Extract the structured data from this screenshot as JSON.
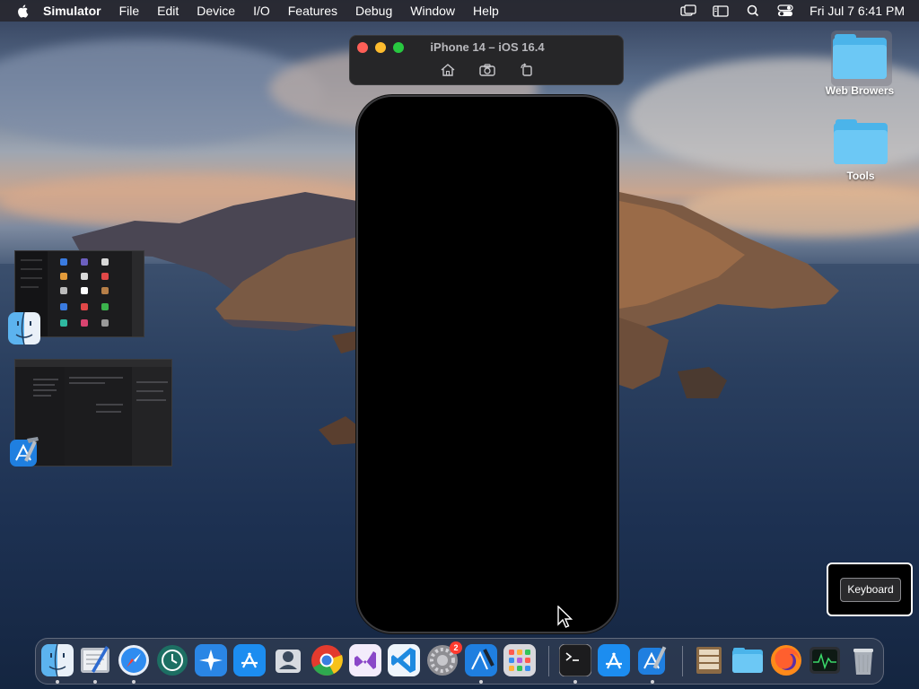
{
  "menubar": {
    "app_name": "Simulator",
    "items": [
      "File",
      "Edit",
      "Device",
      "I/O",
      "Features",
      "Debug",
      "Window",
      "Help"
    ],
    "clock": "Fri Jul 7  6:41 PM",
    "status_icons": [
      "screen-mirroring-icon",
      "display-icon",
      "spotlight-search-icon",
      "control-center-icon"
    ]
  },
  "simulator": {
    "title": "iPhone 14 – iOS 16.4",
    "toolbar": [
      "home-icon",
      "screenshot-icon",
      "rotate-icon"
    ]
  },
  "desktop": {
    "folders": [
      {
        "label": "Web Browers",
        "selected": true
      },
      {
        "label": "Tools",
        "selected": false
      }
    ]
  },
  "keyboard_hint": {
    "label": "Keyboard"
  },
  "dock": {
    "apps": [
      {
        "name": "finder-icon",
        "running": true
      },
      {
        "name": "script-editor-icon",
        "running": true
      },
      {
        "name": "safari-icon",
        "running": true
      },
      {
        "name": "time-machine-icon",
        "running": false
      },
      {
        "name": "testflight-icon",
        "running": false
      },
      {
        "name": "app-store-icon",
        "running": false
      },
      {
        "name": "system-information-icon",
        "running": false
      },
      {
        "name": "chrome-icon",
        "running": false
      },
      {
        "name": "visual-studio-icon",
        "running": false
      },
      {
        "name": "vscode-icon",
        "running": false
      },
      {
        "name": "system-settings-icon",
        "running": false,
        "badge": "2"
      },
      {
        "name": "instruments-icon",
        "running": true
      },
      {
        "name": "launchpad-icon",
        "running": false
      },
      {
        "name": "terminal-icon",
        "running": true
      },
      {
        "name": "app-store-connect-icon",
        "running": false
      },
      {
        "name": "xcode-icon",
        "running": true
      },
      {
        "name": "archive-utility-icon",
        "running": false
      },
      {
        "name": "downloads-folder-icon",
        "running": false
      },
      {
        "name": "firefox-icon",
        "running": false
      },
      {
        "name": "activity-monitor-icon",
        "running": false
      },
      {
        "name": "trash-icon",
        "running": false
      }
    ]
  }
}
